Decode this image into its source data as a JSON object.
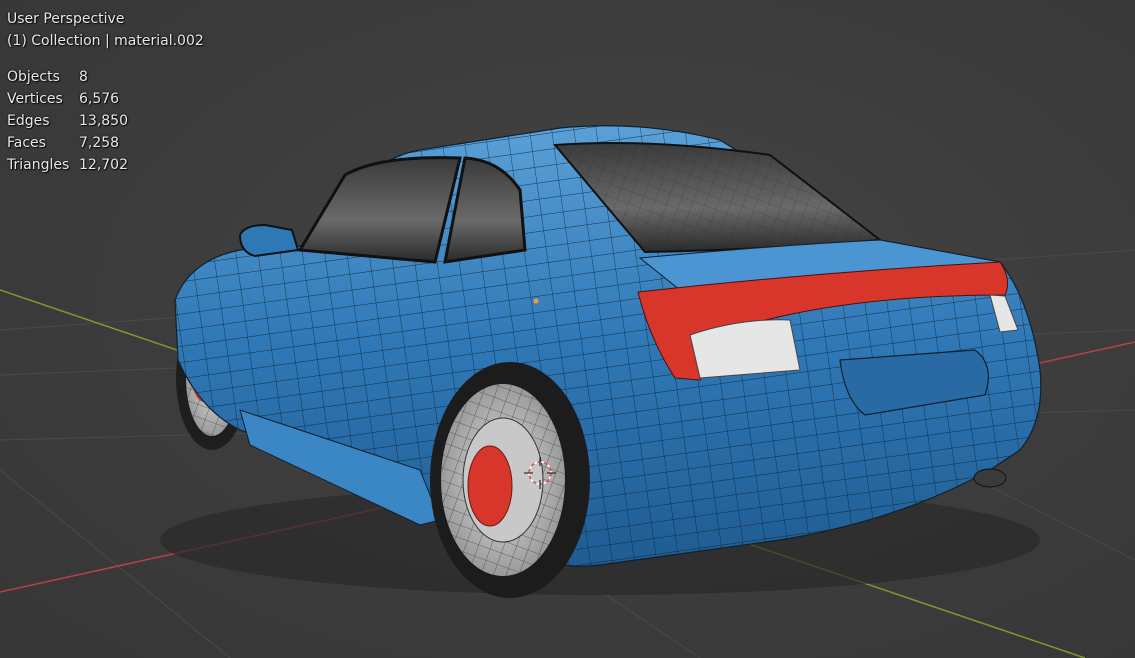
{
  "viewport": {
    "view_name": "User Perspective",
    "collection_line": "(1) Collection | material.002"
  },
  "stats": [
    {
      "label": "Objects",
      "value": "8"
    },
    {
      "label": "Vertices",
      "value": "6,576"
    },
    {
      "label": "Edges",
      "value": "13,850"
    },
    {
      "label": "Faces",
      "value": "7,258"
    },
    {
      "label": "Triangles",
      "value": "12,702"
    }
  ],
  "colors": {
    "background": "#3d3d3d",
    "car_body": "#2f78b6",
    "wheel_hub": "#d8362a",
    "tail_light": "#d8362a",
    "x_axis": "#b8404a",
    "y_axis": "#7c9a2e",
    "wireframe": "#10202c"
  },
  "icons": [
    "3d-cursor-icon"
  ]
}
